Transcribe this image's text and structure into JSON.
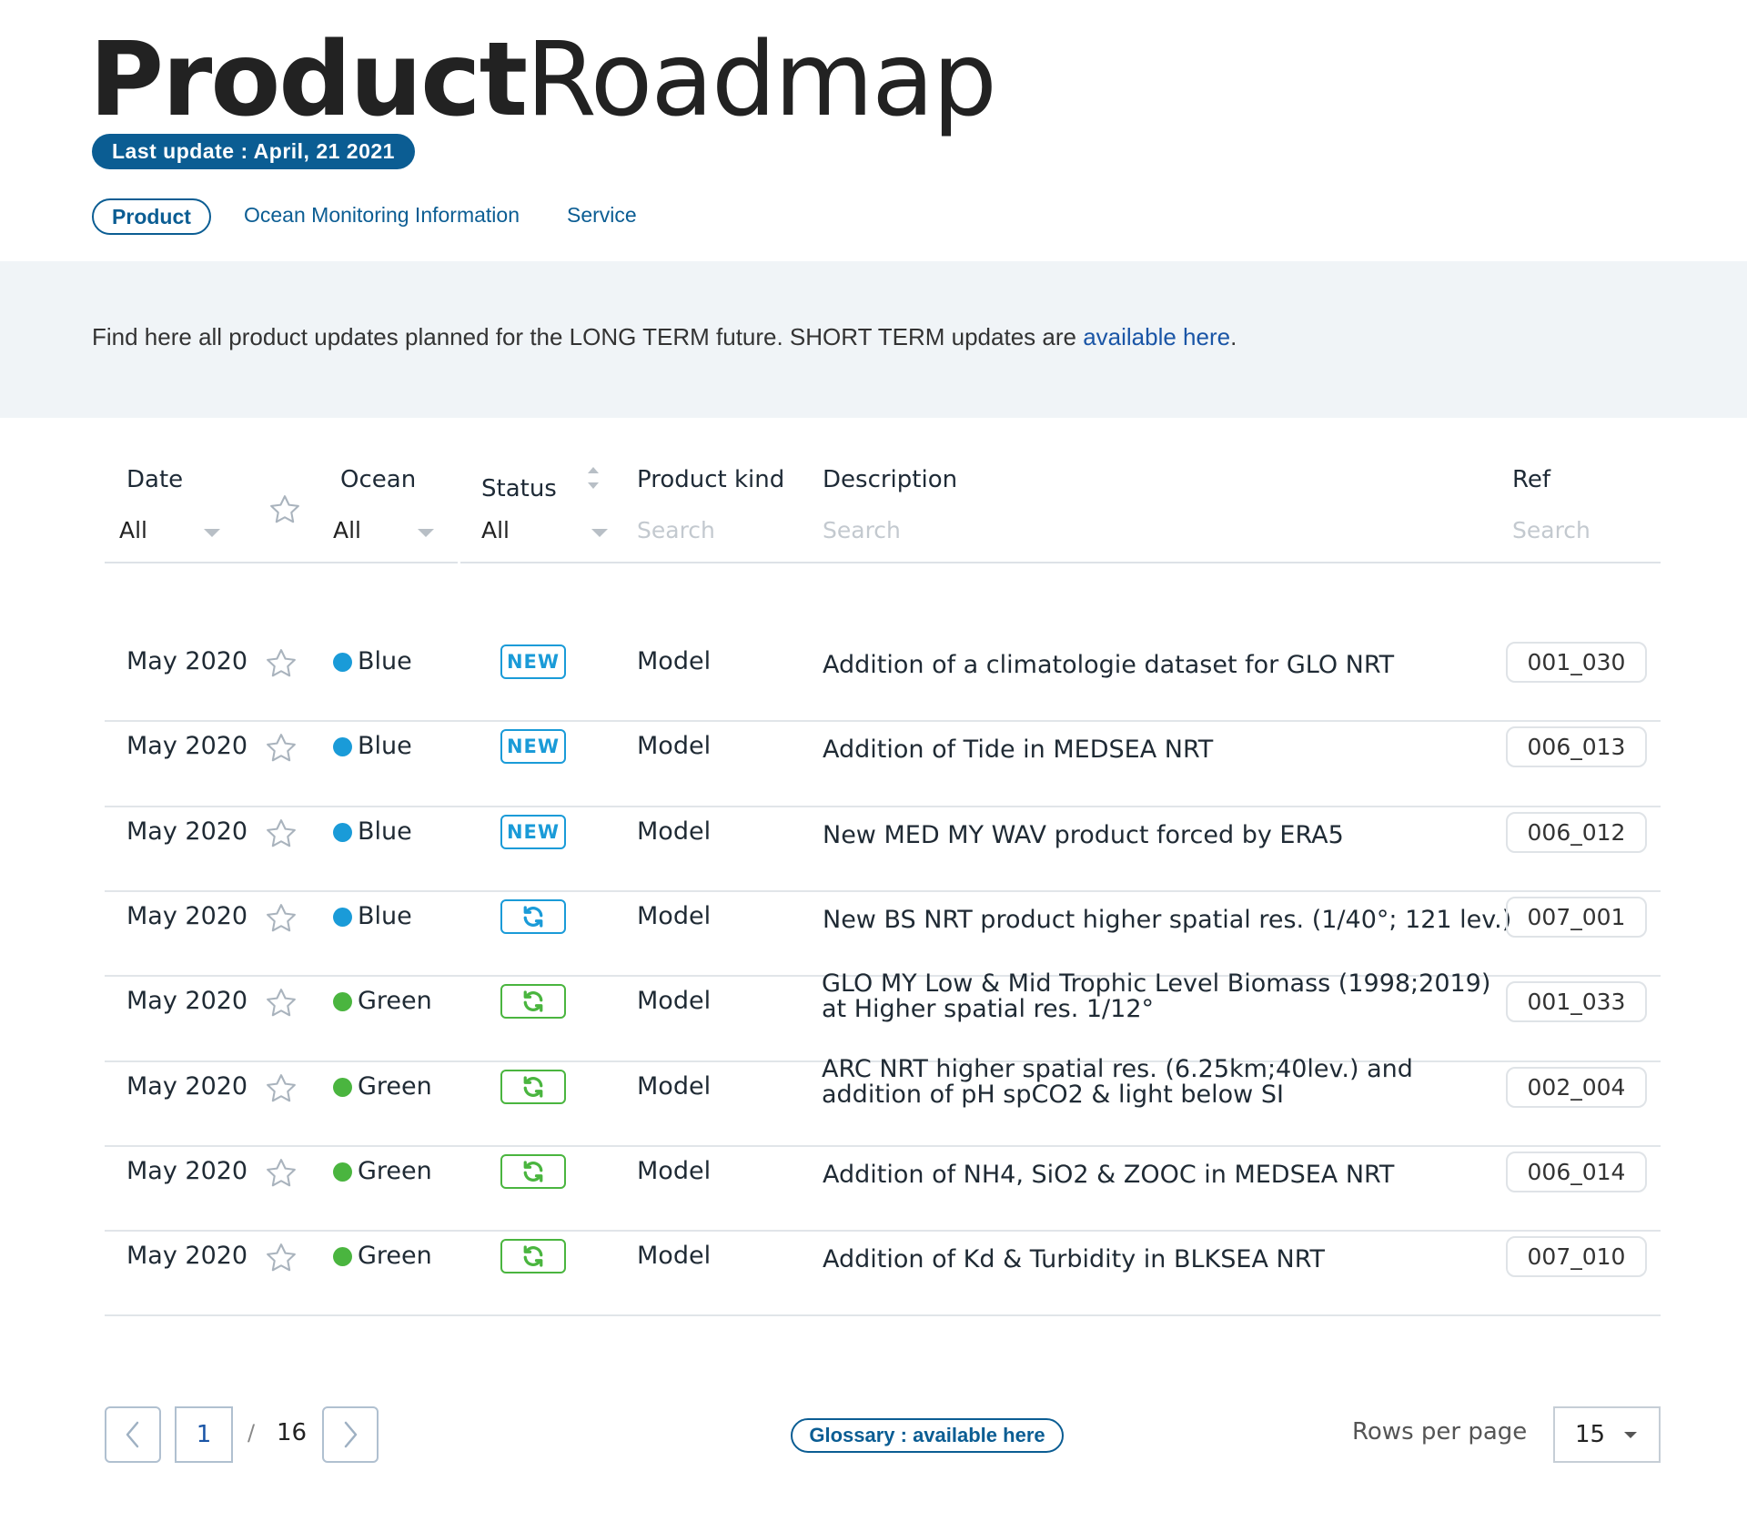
{
  "header": {
    "title_bold": "Product",
    "title_light": "Roadmap",
    "last_update": "Last update :  April, 21 2021"
  },
  "tabs": [
    {
      "label": "Product",
      "active": true
    },
    {
      "label": "Ocean Monitoring Information",
      "active": false
    },
    {
      "label": "Service",
      "active": false
    }
  ],
  "info": {
    "text": "Find here all product updates planned for the LONG TERM future. SHORT TERM updates are ",
    "link": "available here",
    "end": "."
  },
  "table": {
    "columns": {
      "date": "Date",
      "ocean": "Ocean",
      "status": "Status",
      "product_kind": "Product kind",
      "description": "Description",
      "ref": "Ref"
    },
    "filters": {
      "date": "All",
      "ocean": "All",
      "status": "All",
      "product_kind_placeholder": "Search",
      "description_placeholder": "Search",
      "ref_placeholder": "Search"
    },
    "rows": [
      {
        "date": "May 2020",
        "ocean": "Blue",
        "status": "new",
        "status_label": "NEW",
        "kind": "Model",
        "desc1": "Addition of a climatologie dataset for GLO NRT",
        "desc2": "",
        "ref": "001_030"
      },
      {
        "date": "May 2020",
        "ocean": "Blue",
        "status": "new",
        "status_label": "NEW",
        "kind": "Model",
        "desc1": "Addition of Tide in MEDSEA NRT",
        "desc2": "",
        "ref": "006_013"
      },
      {
        "date": "May 2020",
        "ocean": "Blue",
        "status": "new",
        "status_label": "NEW",
        "kind": "Model",
        "desc1": "New MED MY WAV product forced by ERA5",
        "desc2": "",
        "ref": "006_012"
      },
      {
        "date": "May 2020",
        "ocean": "Blue",
        "status": "update",
        "status_label": "",
        "kind": "Model",
        "desc1": "New BS NRT product higher spatial res. (1/40°; 121 lev.)",
        "desc2": "",
        "ref": "007_001"
      },
      {
        "date": "May 2020",
        "ocean": "Green",
        "status": "update",
        "status_label": "",
        "kind": "Model",
        "desc1": "GLO MY Low & Mid Trophic Level Biomass (1998;2019)",
        "desc2": "at Higher spatial res. 1/12°",
        "ref": "001_033"
      },
      {
        "date": "May 2020",
        "ocean": "Green",
        "status": "update",
        "status_label": "",
        "kind": "Model",
        "desc1": "ARC NRT higher spatial res. (6.25km;40lev.) and",
        "desc2": "addition of pH spCO2 & light below SI",
        "ref": "002_004"
      },
      {
        "date": "May 2020",
        "ocean": "Green",
        "status": "update",
        "status_label": "",
        "kind": "Model",
        "desc1": "Addition of NH4, SiO2 & ZOOC in MEDSEA NRT",
        "desc2": "",
        "ref": "006_014"
      },
      {
        "date": "May 2020",
        "ocean": "Green",
        "status": "update",
        "status_label": "",
        "kind": "Model",
        "desc1": "Addition of Kd & Turbidity  in BLKSEA  NRT",
        "desc2": "",
        "ref": "007_010"
      }
    ]
  },
  "pagination": {
    "current_page": "1",
    "separator": "/",
    "total_pages": "16",
    "glossary": "Glossary : available here",
    "rows_per_page_label": "Rows per page",
    "rows_per_page": "15"
  },
  "colors": {
    "brand": "#0b5d93",
    "blue_ocean": "#1a9bd8",
    "green_ocean": "#4ab53f",
    "band_bg": "#f0f4f7"
  },
  "icons": {
    "favorite": "star-outline-icon",
    "update": "refresh-icon",
    "sort": "sort-arrows-icon",
    "prev": "chevron-left-icon",
    "next": "chevron-right-icon",
    "dropdown": "caret-down-icon"
  }
}
